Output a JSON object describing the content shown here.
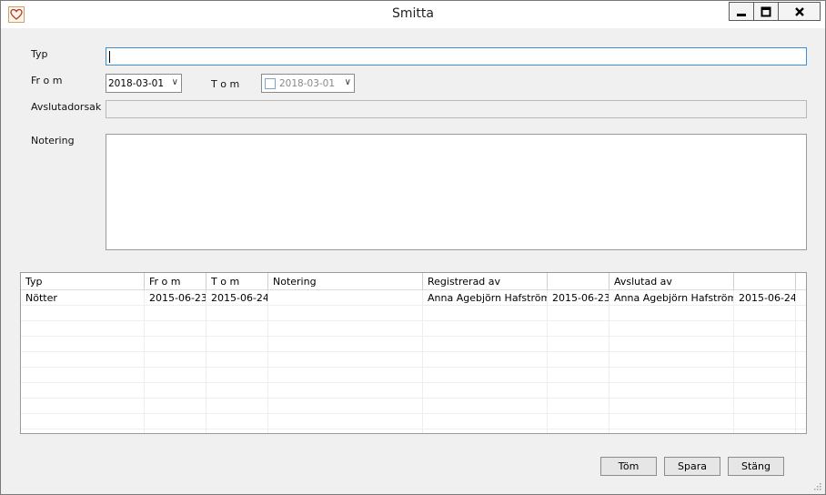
{
  "window": {
    "title": "Smitta"
  },
  "form": {
    "typ_label": "Typ",
    "from_label": "Fr o m",
    "to_label": "T o m",
    "from_value": "2018-03-01",
    "to_value": "2018-03-01",
    "avslutadorsak_label": "Avslutadorsak",
    "notering_label": "Notering"
  },
  "table": {
    "columns": [
      "Typ",
      "Fr o m",
      "T o m",
      "Notering",
      "Registrerad av",
      "",
      "Avslutad av",
      ""
    ],
    "rows": [
      [
        "Nötter",
        "2015-06-23",
        "2015-06-24",
        "",
        "Anna Agebjörn Hafström",
        "2015-06-23",
        "Anna Agebjörn Hafström",
        "2015-06-24"
      ]
    ]
  },
  "buttons": {
    "clear": "Töm",
    "save": "Spara",
    "close": "Stäng"
  },
  "icons": {
    "app": "heart-icon",
    "minimize": "minimize-icon",
    "maximize": "maximize-icon",
    "close": "close-icon",
    "dropdown": "chevron-down-icon",
    "grip": "resize-grip-icon"
  }
}
